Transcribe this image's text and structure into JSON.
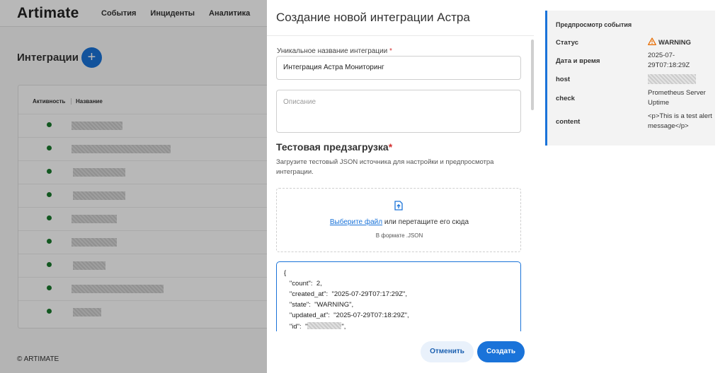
{
  "app": {
    "logo": "Artimate",
    "nav": [
      "События",
      "Инциденты",
      "Аналитика"
    ],
    "page_title": "Интеграции",
    "add_button": "+",
    "table_headers": {
      "active": "Активность",
      "name": "Название"
    },
    "footer": "© ARTIMATE"
  },
  "modal": {
    "title": "Создание новой интеграции Астра",
    "name_label": "Уникальное название интеграции",
    "required_mark": "*",
    "name_value": "Интеграция Астра Мониторинг",
    "description_placeholder": "Описание",
    "section_title": "Тестовая предзагрузка",
    "section_description": "Загрузите тестовый JSON источника для настройки и предпросмотра интеграции.",
    "dropzone": {
      "link_text": "Выберите файл",
      "rest_text": " или перетащите его сюда",
      "hint": "В формате .JSON"
    },
    "json_lines": [
      "{",
      "   \"count\":  2,",
      "   \"created_at\":  \"2025-07-29T07:17:29Z\",",
      "   \"state\":  \"WARNING\",",
      "   \"updated_at\":  \"2025-07-29T07:18:29Z\",",
      "   \"id\":  \""
    ],
    "json_tail": "\",",
    "cancel_label": "Отменить",
    "create_label": "Создать"
  },
  "preview": {
    "title": "Предпросмотр события",
    "status_key": "Статус",
    "status_value": "WARNING",
    "date_key": "Дата и время",
    "date_value": "2025-07-29T07:18:29Z",
    "host_key": "host",
    "check_key": "check",
    "check_value": "Prometheus Server Uptime",
    "content_key": "content",
    "content_value": "<p>This is a test alert message</p>",
    "warning_color": "#e8710a"
  }
}
